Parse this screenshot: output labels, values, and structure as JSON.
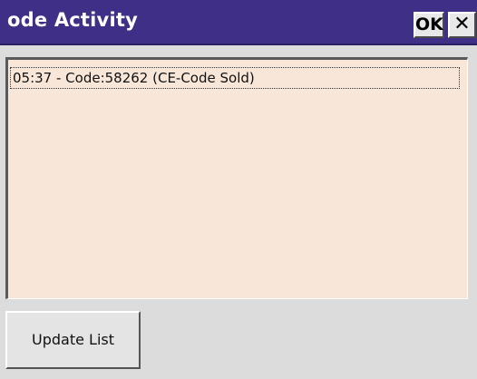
{
  "window": {
    "title": "ode Activity",
    "ok_label": "OK",
    "close_label": "✕"
  },
  "list": {
    "items": [
      "05:37 - Code:58262 (CE-Code Sold)"
    ]
  },
  "buttons": {
    "update_list_label": "Update List"
  },
  "colors": {
    "titlebar": "#3f2f86",
    "list_background": "#f8e7d9",
    "window_background": "#dcdcdc"
  }
}
